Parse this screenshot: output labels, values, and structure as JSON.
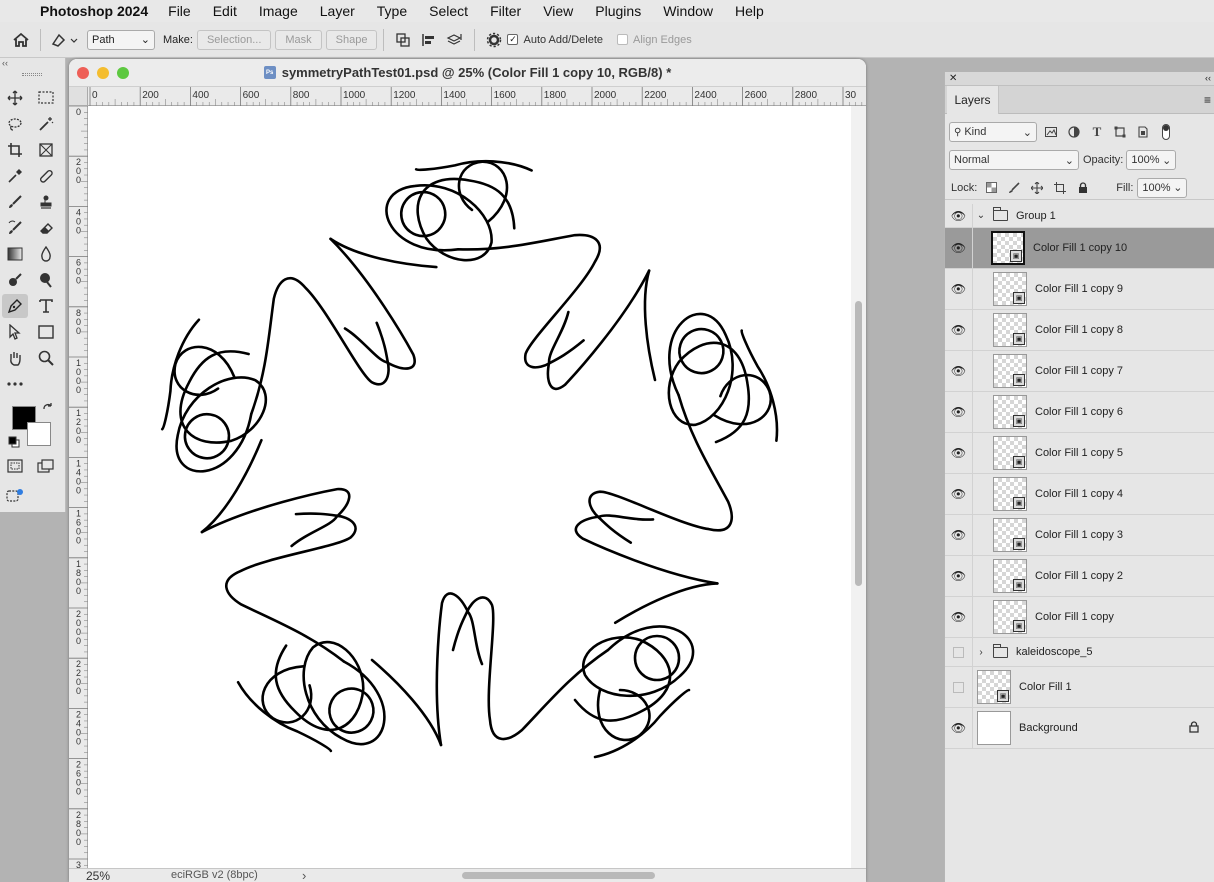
{
  "menubar": {
    "app": "Photoshop 2024",
    "items": [
      "File",
      "Edit",
      "Image",
      "Layer",
      "Type",
      "Select",
      "Filter",
      "View",
      "Plugins",
      "Window",
      "Help"
    ]
  },
  "options": {
    "mode": "Path",
    "make_label": "Make:",
    "selection": "Selection...",
    "mask": "Mask",
    "shape": "Shape",
    "auto_add_delete": "Auto Add/Delete",
    "align_edges": "Align Edges"
  },
  "document": {
    "title": "symmetryPathTest01.psd @ 25% (Color Fill 1 copy 10, RGB/8) *",
    "zoom": "25%",
    "profile": "eciRGB v2 (8bpc)",
    "status_arrow": "›"
  },
  "rulers": {
    "h_ticks": [
      "0",
      "200",
      "400",
      "600",
      "800",
      "1000",
      "1200",
      "1400",
      "1600",
      "1800",
      "2000",
      "2200",
      "2400",
      "2600",
      "2800",
      "30"
    ],
    "v_ticks": [
      "0",
      "200",
      "400",
      "600",
      "800",
      "1000",
      "1200",
      "1400",
      "1600",
      "1800",
      "2000",
      "2200",
      "2400",
      "2600",
      "2800",
      "3"
    ]
  },
  "layers_panel": {
    "tab": "Layers",
    "kind": "Kind",
    "blend": "Normal",
    "opacity_label": "Opacity:",
    "opacity": "100%",
    "lock_label": "Lock:",
    "fill_label": "Fill:",
    "fill": "100%",
    "layers": [
      {
        "name": "Group 1",
        "group": true,
        "expanded": true,
        "visible": true
      },
      {
        "name": "Color Fill 1 copy 10",
        "visible": true,
        "selected": true
      },
      {
        "name": "Color Fill 1 copy 9",
        "visible": true
      },
      {
        "name": "Color Fill 1 copy 8",
        "visible": true
      },
      {
        "name": "Color Fill 1 copy 7",
        "visible": true
      },
      {
        "name": "Color Fill 1 copy 6",
        "visible": true
      },
      {
        "name": "Color Fill 1 copy 5",
        "visible": true
      },
      {
        "name": "Color Fill 1 copy 4",
        "visible": true
      },
      {
        "name": "Color Fill 1 copy 3",
        "visible": true
      },
      {
        "name": "Color Fill 1 copy 2",
        "visible": true
      },
      {
        "name": "Color Fill 1 copy",
        "visible": true
      },
      {
        "name": "kaleidoscope_5",
        "group": true,
        "expanded": false,
        "visible": false
      },
      {
        "name": "Color Fill 1",
        "visible": false,
        "top_level": true
      },
      {
        "name": "Background",
        "visible": true,
        "top_level": true,
        "locked": true
      }
    ]
  }
}
